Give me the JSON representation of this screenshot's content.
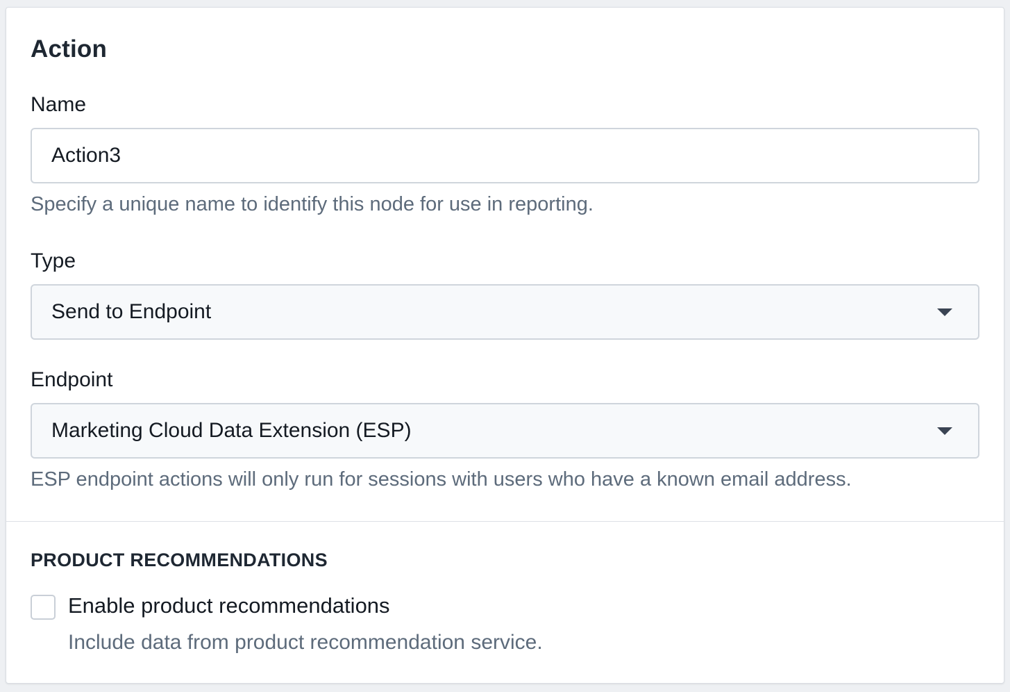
{
  "action_panel": {
    "title": "Action",
    "name_field": {
      "label": "Name",
      "value": "Action3",
      "help": "Specify a unique name to identify this node for use in reporting."
    },
    "type_field": {
      "label": "Type",
      "selected": "Send to Endpoint"
    },
    "endpoint_field": {
      "label": "Endpoint",
      "selected": "Marketing Cloud Data Extension (ESP)",
      "help": "ESP endpoint actions will only run for sessions with users who have a known email address."
    }
  },
  "product_recommendations": {
    "title": "PRODUCT RECOMMENDATIONS",
    "checkbox": {
      "label": "Enable product recommendations",
      "checked": false,
      "help": "Include data from product recommendation service."
    }
  },
  "icons": {
    "dropdown": "caret-down-icon"
  }
}
